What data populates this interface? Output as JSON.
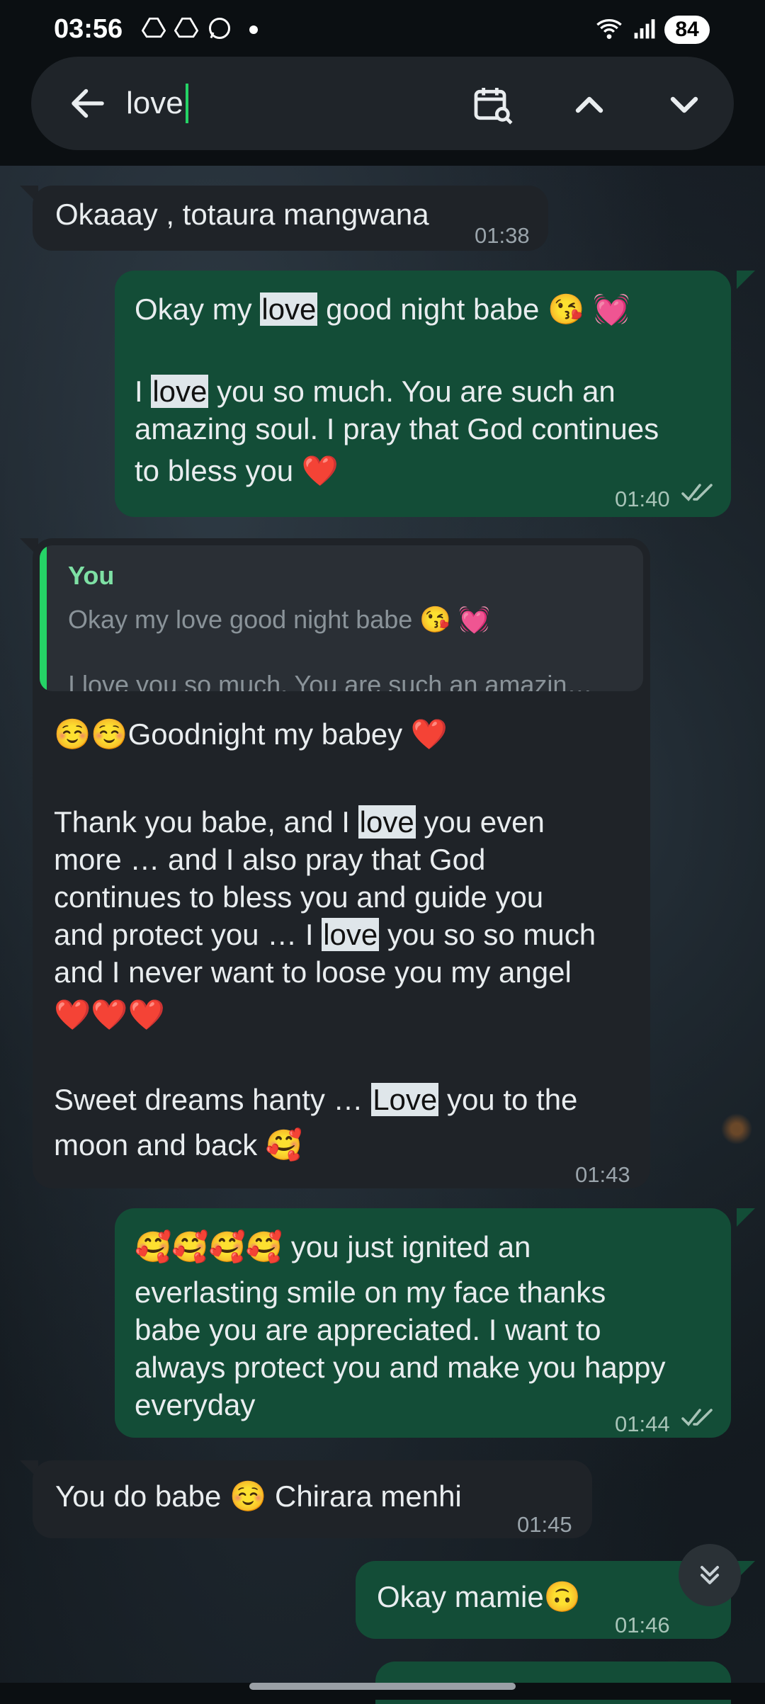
{
  "status_bar": {
    "time": "03:56",
    "battery": "84",
    "icons": [
      "drive-icon",
      "drive-icon",
      "whatsapp-icon",
      "dot-icon",
      "wifi-icon",
      "signal-icon"
    ]
  },
  "search": {
    "query": "love",
    "icons": [
      "back-arrow-icon",
      "calendar-search-icon",
      "chevron-up-icon",
      "chevron-down-icon"
    ]
  },
  "messages": [
    {
      "dir": "in",
      "lines": [
        "Okaaay , totaura mangwana"
      ],
      "time": "01:38"
    },
    {
      "dir": "out",
      "time": "01:40",
      "line1": {
        "a": "Okay my ",
        "hl": "love",
        "b": " good night babe 😘 💓"
      },
      "line3": {
        "a": "I ",
        "hl": "love",
        "b": " you so much. You are such an"
      },
      "line4": "amazing soul. I pray that God continues",
      "line5": "to bless you ❤️"
    },
    {
      "dir": "in",
      "time": "01:43",
      "quote": {
        "author": "You",
        "line1": "Okay my love good night babe 😘 💓",
        "line2": "I love you so much. You are such an amazin…"
      },
      "l1": "☺️☺️Goodnight my babey ❤️",
      "l3": {
        "a": "Thank you babe, and I ",
        "hl": "love",
        "b": " you even"
      },
      "l4": "more … and I also pray that God",
      "l5": "continues to bless you and guide you",
      "l6": {
        "a": "and protect you … I ",
        "hl": "love",
        "b": " you so so much"
      },
      "l7": "and I never want to loose you my angel",
      "l8": "❤️❤️❤️",
      "l10": {
        "a": "Sweet dreams hanty … ",
        "hl": "Love",
        "b": " you to the"
      },
      "l11": "moon and back 🥰"
    },
    {
      "dir": "out",
      "time": "01:44",
      "lines": [
        "🥰🥰🥰🥰 you just ignited an",
        "everlasting smile on my face thanks",
        "babe you are appreciated. I want to",
        "always protect you and make you happy",
        "everyday"
      ]
    },
    {
      "dir": "in",
      "time": "01:45",
      "lines": [
        "You do babe ☺️ Chirara menhi"
      ]
    },
    {
      "dir": "out",
      "time": "01:46",
      "lines": [
        "Okay mamie🙃"
      ]
    }
  ]
}
